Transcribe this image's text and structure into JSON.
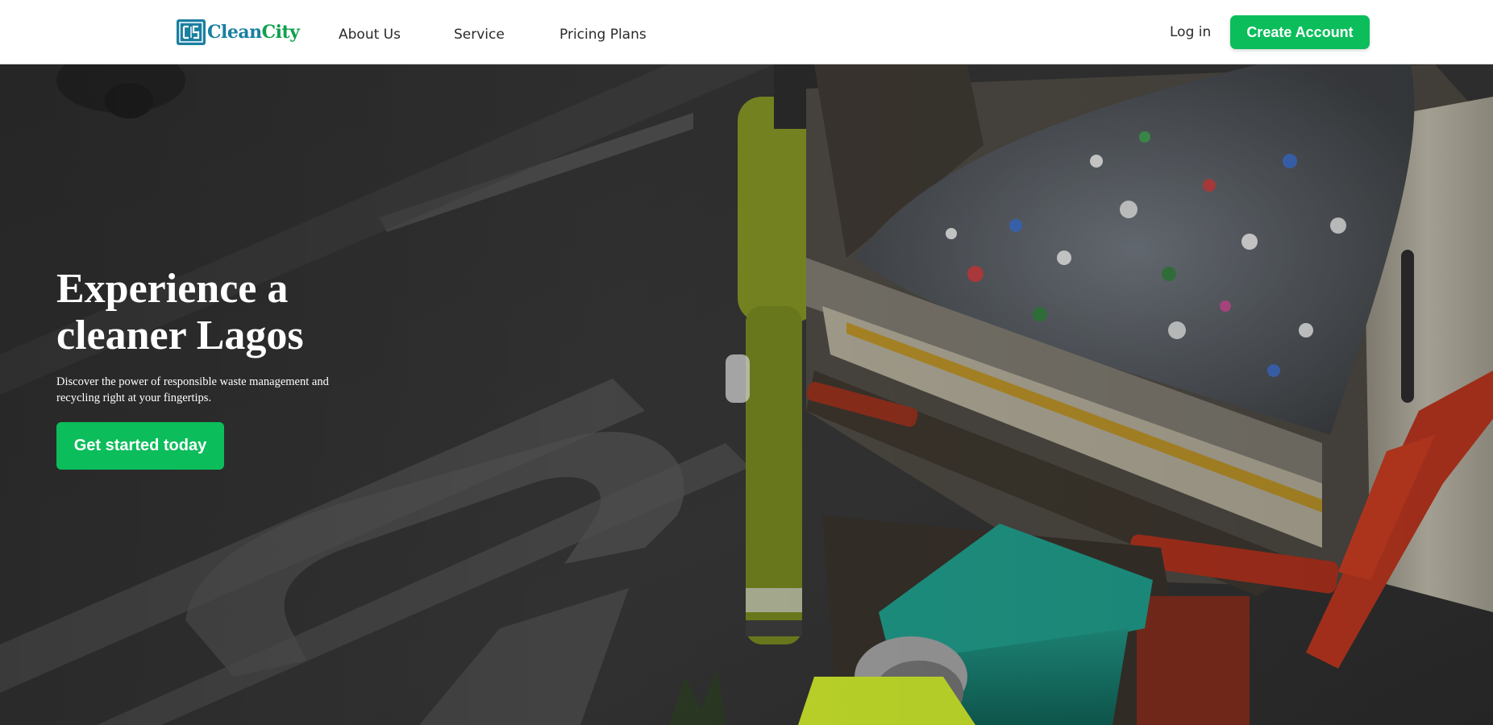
{
  "brand": {
    "name_part1": "Clean",
    "name_part2": "City",
    "mark_text": "CS",
    "colors": {
      "primary_blue": "#1a7fa0",
      "primary_green": "#0fa04c",
      "button_green": "#0bbd5b"
    }
  },
  "nav": {
    "links": [
      {
        "label": "About Us"
      },
      {
        "label": "Service"
      },
      {
        "label": "Pricing Plans"
      }
    ],
    "login_label": "Log in",
    "create_account_label": "Create Account"
  },
  "hero": {
    "title": "Experience a cleaner Lagos",
    "subtitle": "Discover the power of responsible waste management and recycling right at your fingertips.",
    "cta_label": "Get started today",
    "background_image": "garbage-truck-collection-photo"
  }
}
